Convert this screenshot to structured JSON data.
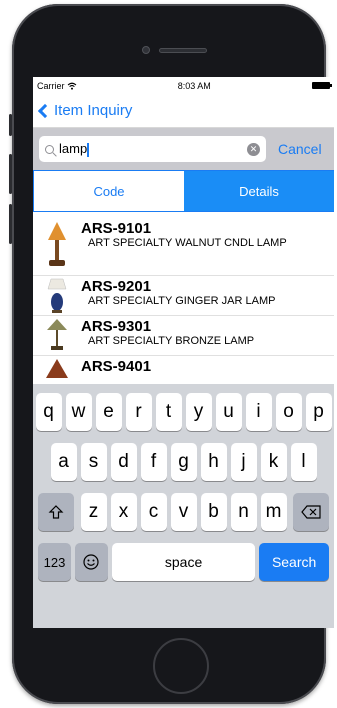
{
  "status_bar": {
    "carrier": "Carrier",
    "time": "8:03 AM"
  },
  "nav": {
    "back_label": "Item Inquiry"
  },
  "search": {
    "value": "lamp",
    "cancel_label": "Cancel"
  },
  "segments": {
    "code_label": "Code",
    "details_label": "Details",
    "selected": "Details"
  },
  "items": [
    {
      "code": "ARS-9101",
      "description": "ART SPECIALTY WALNUT CNDL LAMP"
    },
    {
      "code": "ARS-9201",
      "description": "ART SPECIALTY GINGER JAR LAMP"
    },
    {
      "code": "ARS-9301",
      "description": "ART SPECIALTY BRONZE LAMP"
    },
    {
      "code": "ARS-9401",
      "description": ""
    }
  ],
  "keyboard": {
    "row1": [
      "q",
      "w",
      "e",
      "r",
      "t",
      "y",
      "u",
      "i",
      "o",
      "p"
    ],
    "row2": [
      "a",
      "s",
      "d",
      "f",
      "g",
      "h",
      "j",
      "k",
      "l"
    ],
    "row3": [
      "z",
      "x",
      "c",
      "v",
      "b",
      "n",
      "m"
    ],
    "numbers_label": "123",
    "space_label": "space",
    "search_label": "Search"
  },
  "colors": {
    "accent": "#1a7cf3",
    "segment_selected": "#1a8df6"
  }
}
